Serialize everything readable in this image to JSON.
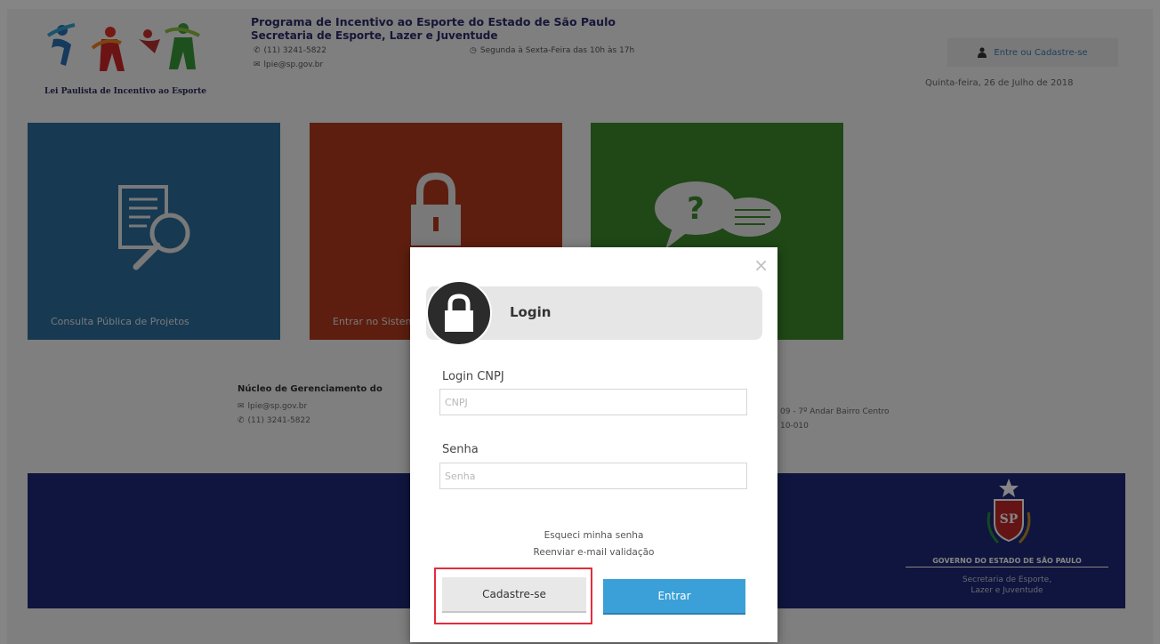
{
  "header": {
    "logo_caption": "Lei Paulista de Incentivo ao Esporte",
    "title": "Programa de Incentivo ao Esporte do Estado de São Paulo",
    "subtitle": "Secretaria de Esporte, Lazer e Juventude",
    "phone": "(11) 3241-5822",
    "hours": "Segunda à Sexta-Feira das 10h às 17h",
    "email": "lpie@sp.gov.br",
    "login_button": "Entre ou Cadastre-se",
    "date": "Quinta-feira, 26 de Julho de 2018"
  },
  "tiles": {
    "consulta": "Consulta Pública de Projetos",
    "entrar": "Entrar no Sistema"
  },
  "footer": {
    "nucleo_title": "Núcleo de Gerenciamento do",
    "email": "lpie@sp.gov.br",
    "phone": "(11) 3241-5822",
    "address": "09 - 7º Andar Bairro Centro",
    "cep": "10-010",
    "gov_title": "GOVERNO DO ESTADO DE SÃO PAULO",
    "gov_sub1": "Secretaria de Esporte,",
    "gov_sub2": "Lazer e Juventude"
  },
  "modal": {
    "close": "×",
    "title": "Login",
    "cnpj_label": "Login CNPJ",
    "cnpj_placeholder": "CNPJ",
    "senha_label": "Senha",
    "senha_placeholder": "Senha",
    "forgot_link": "Esqueci minha senha",
    "resend_link": "Reenviar e-mail validação",
    "register_button": "Cadastre-se",
    "submit_button": "Entrar"
  },
  "colors": {
    "tile_blue": "#2d6e9e",
    "tile_red": "#b23a1e",
    "tile_green": "#3c8a2b",
    "footer_band": "#1e2a78",
    "primary_button": "#3ba0d8",
    "highlight": "#e32c3c"
  }
}
